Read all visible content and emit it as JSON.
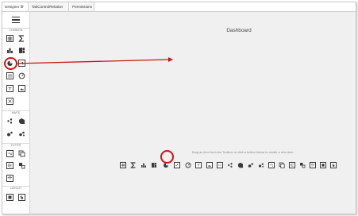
{
  "tabs": [
    {
      "label": "Designer",
      "active": true
    },
    {
      "label": "TabControlRelation",
      "active": false
    },
    {
      "label": "Permissions",
      "active": false
    }
  ],
  "toolbox": {
    "sections": [
      "COMMON",
      "MAPS",
      "FILTER",
      "LAYOUT"
    ]
  },
  "canvas": {
    "title": "Dashboard",
    "hint": "Drag an item from the Toolbox or click a button below to create a new item."
  },
  "colors": {
    "highlight": "#d0121a",
    "icon": "#3a3a3a",
    "canvas_bg": "#f0f0f0"
  }
}
